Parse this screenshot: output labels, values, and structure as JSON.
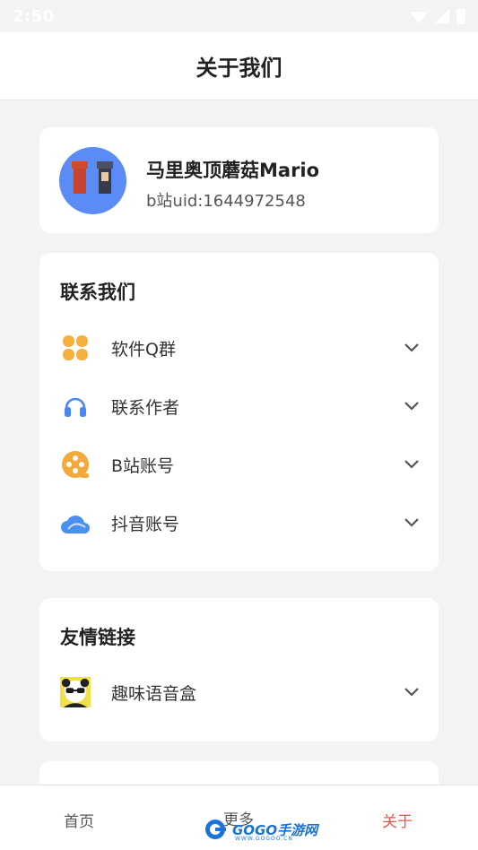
{
  "status_bar": {
    "time": "2:50"
  },
  "header": {
    "title": "关于我们"
  },
  "profile": {
    "name": "马里奥顶蘑菇Mario",
    "uid": "b站uid:1644972548"
  },
  "contact": {
    "title": "联系我们",
    "items": [
      {
        "label": "软件Q群",
        "icon": "grid-flower-icon",
        "color": "#f5b041"
      },
      {
        "label": "联系作者",
        "icon": "headphones-icon",
        "color": "#4a86f0"
      },
      {
        "label": "B站账号",
        "icon": "film-reel-icon",
        "color": "#f5a93a"
      },
      {
        "label": "抖音账号",
        "icon": "cloud-icon",
        "color": "#4a90f0"
      }
    ]
  },
  "links": {
    "title": "友情链接",
    "items": [
      {
        "label": "趣味语音盒",
        "icon": "panda-avatar-icon"
      }
    ]
  },
  "tabbar": {
    "items": [
      {
        "label": "首页"
      },
      {
        "label": "更多"
      },
      {
        "label": "关于"
      }
    ],
    "active_color": "#e8554e"
  },
  "watermark": {
    "text": "GOGO手游网",
    "sub": "WWW.GOGOO.CN"
  }
}
